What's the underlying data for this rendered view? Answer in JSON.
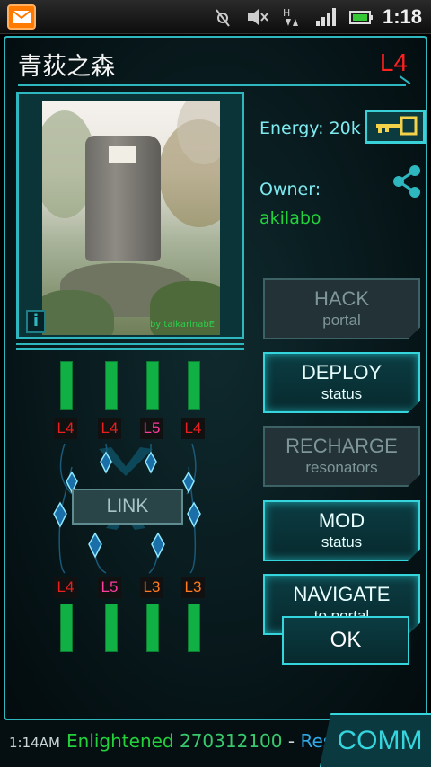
{
  "statusbar": {
    "time": "1:18",
    "icons": [
      "mail-icon",
      "gps-icon",
      "mute-icon",
      "data-transfer-icon",
      "signal-icon",
      "battery-icon"
    ],
    "mail_color": "#ff7a00"
  },
  "portal": {
    "name": "青荻之森",
    "level": "L4",
    "photo_credit": "by taikarinabE",
    "info_button": "i"
  },
  "info": {
    "energy_label": "Energy: 20k",
    "owner_label": "Owner:",
    "owner_name": "akilabo",
    "owner_color": "#22d13c"
  },
  "actions": [
    {
      "line1": "HACK",
      "line2": "portal",
      "enabled": false
    },
    {
      "line1": "DEPLOY",
      "line2": "status",
      "enabled": true
    },
    {
      "line1": "RECHARGE",
      "line2": "resonators",
      "enabled": false
    },
    {
      "line1": "MOD",
      "line2": "status",
      "enabled": true
    },
    {
      "line1": "NAVIGATE",
      "line2": "to portal",
      "enabled": true
    }
  ],
  "ok_label": "OK",
  "link_label": "LINK",
  "resonators": {
    "top": [
      {
        "level": "L4",
        "color": "#e82020"
      },
      {
        "level": "L4",
        "color": "#e82020"
      },
      {
        "level": "L5",
        "color": "#ff3ca0"
      },
      {
        "level": "L4",
        "color": "#e82020"
      }
    ],
    "bottom": [
      {
        "level": "L4",
        "color": "#e82020"
      },
      {
        "level": "L5",
        "color": "#ff3ca0"
      },
      {
        "level": "L3",
        "color": "#ff7a20"
      },
      {
        "level": "L3",
        "color": "#ff7a20"
      }
    ]
  },
  "comm": {
    "time": "1:14AM",
    "faction": "Enlightened",
    "number": "270312100",
    "dash": "-",
    "rest": "Res",
    "button": "COMM"
  }
}
